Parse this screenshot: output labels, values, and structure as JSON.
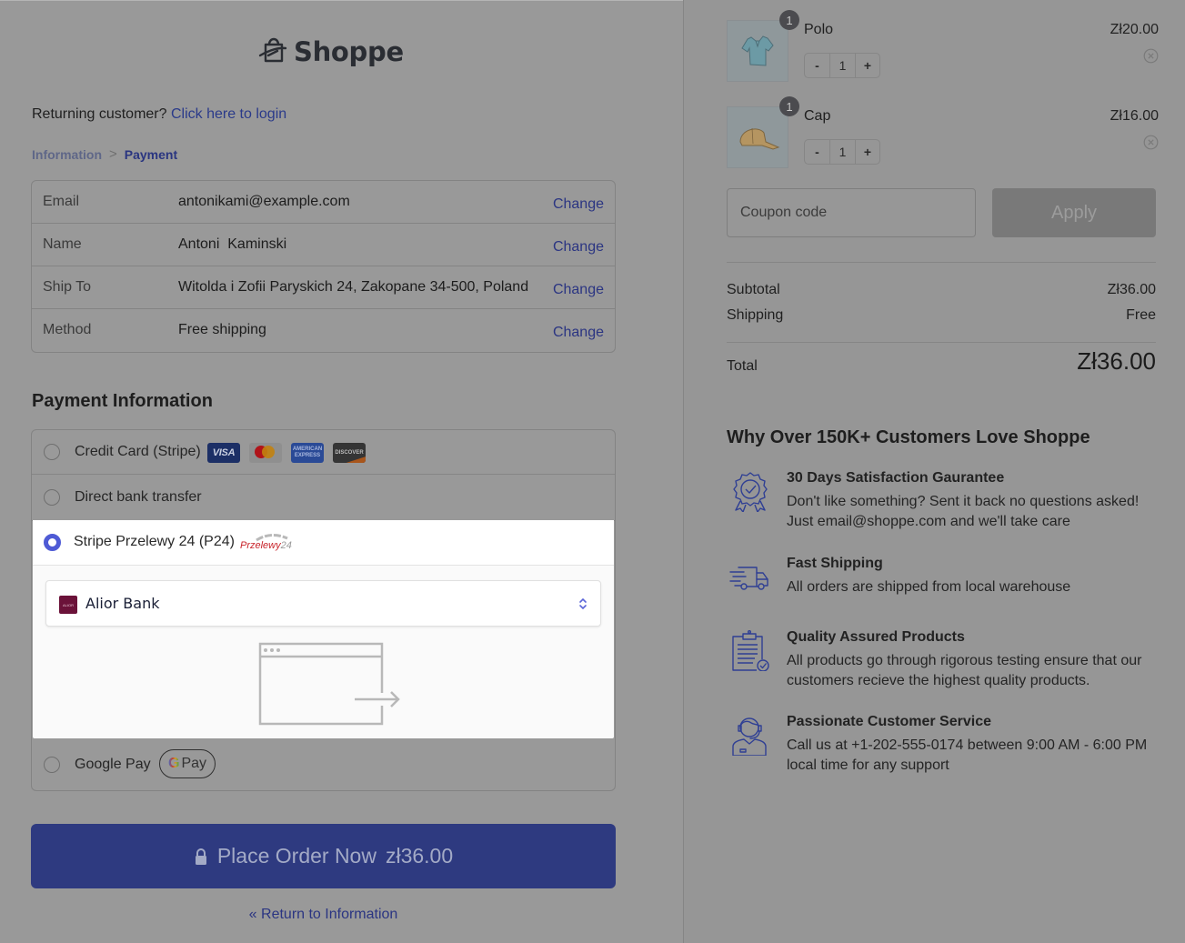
{
  "brand": {
    "name": "Shoppe",
    "logo_icon": "shopping-bag-icon"
  },
  "login_prompt": {
    "text": "Returning customer?",
    "link": "Click here to login"
  },
  "breadcrumb": {
    "items": [
      "Information",
      "Payment"
    ],
    "separator": ">",
    "current": "Payment"
  },
  "customer_info": {
    "rows": [
      {
        "label": "Email",
        "value": "antonikami@example.com",
        "action": "Change"
      },
      {
        "label": "Name",
        "value": "Antoni  Kaminski",
        "action": "Change"
      },
      {
        "label": "Ship To",
        "value": "Witolda i Zofii Paryskich 24, Zakopane 34-500, Poland",
        "action": "Change"
      },
      {
        "label": "Method",
        "value": "Free shipping",
        "action": "Change"
      }
    ]
  },
  "payment": {
    "heading": "Payment Information",
    "methods": [
      {
        "label": "Credit Card (Stripe)",
        "selected": false,
        "card_logos": [
          "VISA",
          "mastercard",
          "AMERICAN EXPRESS",
          "DISCOVER"
        ]
      },
      {
        "label": "Direct bank transfer",
        "selected": false
      },
      {
        "label": "Stripe Przelewy 24 (P24)",
        "selected": true,
        "logo_text": "Przelewy",
        "logo_suffix": "24"
      },
      {
        "label": "Google Pay",
        "selected": false,
        "badge": {
          "g": "G",
          "pay": "Pay"
        }
      }
    ],
    "p24": {
      "bank_logo_text": "ALIOR",
      "bank_selected": "Alior Bank",
      "redirect_icon": "browser-redirect-icon"
    }
  },
  "place_order": {
    "label": "Place Order Now",
    "amount": "zł36.00",
    "icon": "lock-icon"
  },
  "return_link": "« Return to Information",
  "cart": {
    "items": [
      {
        "name": "Polo",
        "quantity": "1",
        "badge": "1",
        "price": "Zł20.00",
        "minus": "-",
        "plus": "+"
      },
      {
        "name": "Cap",
        "quantity": "1",
        "badge": "1",
        "price": "Zł16.00",
        "minus": "-",
        "plus": "+"
      }
    ],
    "coupon": {
      "placeholder": "Coupon code",
      "value": "",
      "apply_label": "Apply"
    },
    "summary": {
      "subtotal_label": "Subtotal",
      "subtotal": "Zł36.00",
      "shipping_label": "Shipping",
      "shipping": "Free",
      "total_label": "Total",
      "total": "Zł36.00"
    }
  },
  "why": {
    "heading": "Why Over 150K+ Customers Love Shoppe",
    "features": [
      {
        "icon": "award-badge-icon",
        "title": "30 Days Satisfaction Gaurantee",
        "desc": "Don't like something? Sent it back no questions asked! Just email@shoppe.com and we'll take care"
      },
      {
        "icon": "delivery-truck-icon",
        "title": "Fast Shipping",
        "desc": "All orders are shipped from local warehouse"
      },
      {
        "icon": "clipboard-check-icon",
        "title": "Quality Assured Products",
        "desc": "All products go through rigorous testing ensure that our customers recieve the highest quality products."
      },
      {
        "icon": "support-agent-icon",
        "title": "Passionate Customer Service",
        "desc": "Call us at +1-202-555-0174 between 9:00 AM - 6:00 PM local time for any support"
      }
    ]
  },
  "colors": {
    "accent": "#2e3a80",
    "link": "#2b3582",
    "radio_selected": "#4f5bd5",
    "icon_blue": "#2f3f94"
  }
}
